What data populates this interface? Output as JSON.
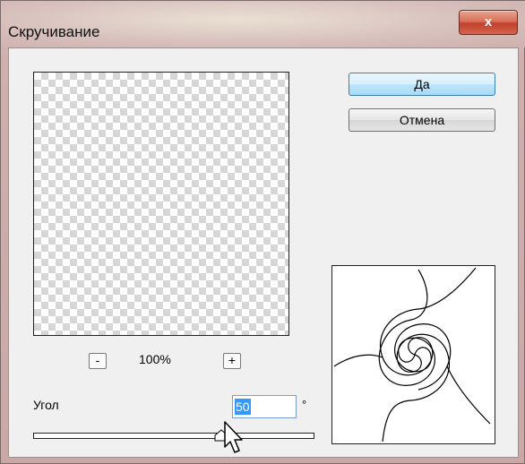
{
  "window": {
    "title": "Скручивание",
    "close_label": "x"
  },
  "buttons": {
    "ok_label": "Да",
    "cancel_label": "Отмена"
  },
  "zoom": {
    "minus_label": "-",
    "plus_label": "+",
    "value": "100%"
  },
  "angle": {
    "label": "Угол",
    "value": "50",
    "unit": "°",
    "slider_position": 0.68
  },
  "icons": {
    "preview": "transparency-checkerboard",
    "swirl": "twirl-preview-icon",
    "cursor": "mouse-pointer-icon"
  }
}
